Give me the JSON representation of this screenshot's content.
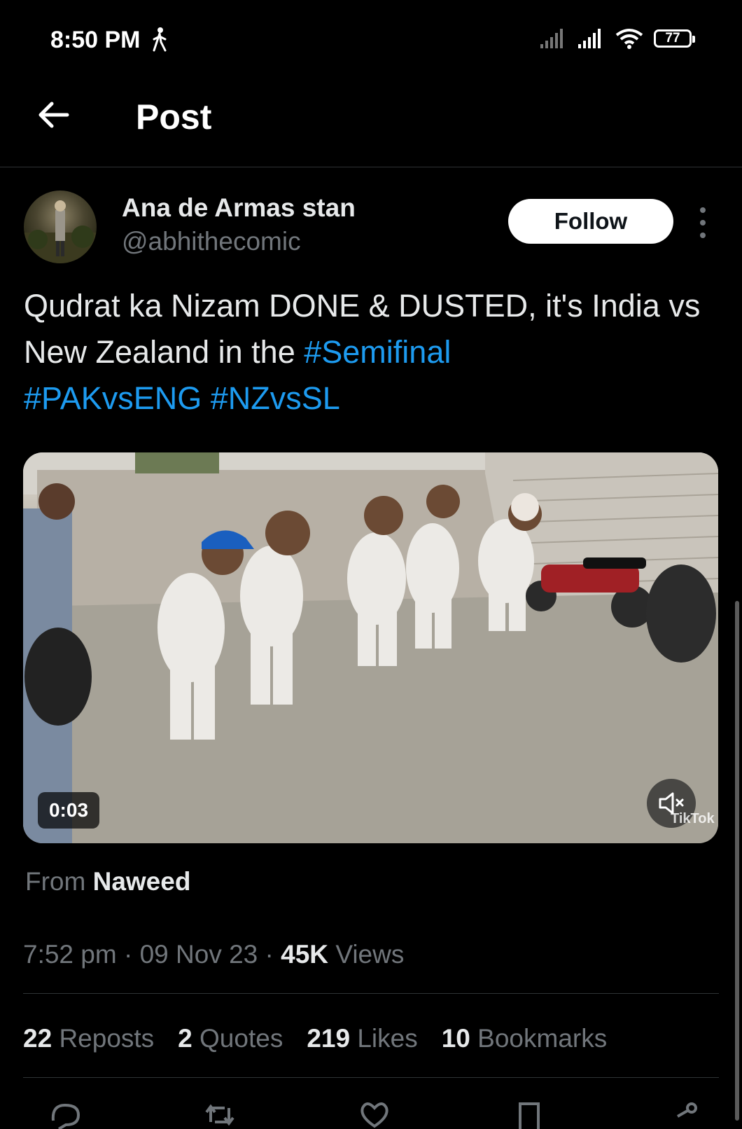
{
  "status_bar": {
    "time": "8:50 PM",
    "battery": "77"
  },
  "header": {
    "title": "Post"
  },
  "author": {
    "name": "Ana de Armas stan",
    "handle": "@abhithecomic",
    "follow_label": "Follow"
  },
  "tweet": {
    "text_plain": "Qudrat ka Nizam DONE & DUSTED, it's India vs New Zealand in the ",
    "hashtags": [
      "#Semifinal",
      "#PAKvsENG",
      "#NZvsSL"
    ]
  },
  "media": {
    "duration": "0:03",
    "watermark": "TikTok"
  },
  "source": {
    "prefix": "From",
    "name": "Naweed"
  },
  "meta": {
    "time": "7:52 pm",
    "date": "09 Nov 23",
    "views_count": "45K",
    "views_label": "Views",
    "separator": "·"
  },
  "stats": [
    {
      "count": "22",
      "label": "Reposts"
    },
    {
      "count": "2",
      "label": "Quotes"
    },
    {
      "count": "219",
      "label": "Likes"
    },
    {
      "count": "10",
      "label": "Bookmarks"
    }
  ],
  "actions": [
    "reply-icon",
    "repost-icon",
    "like-icon",
    "bookmark-icon",
    "share-icon"
  ],
  "colors": {
    "background": "#000000",
    "text": "#e7e9ea",
    "muted": "#71767b",
    "link": "#1d9bf0",
    "divider": "#2f3336"
  }
}
